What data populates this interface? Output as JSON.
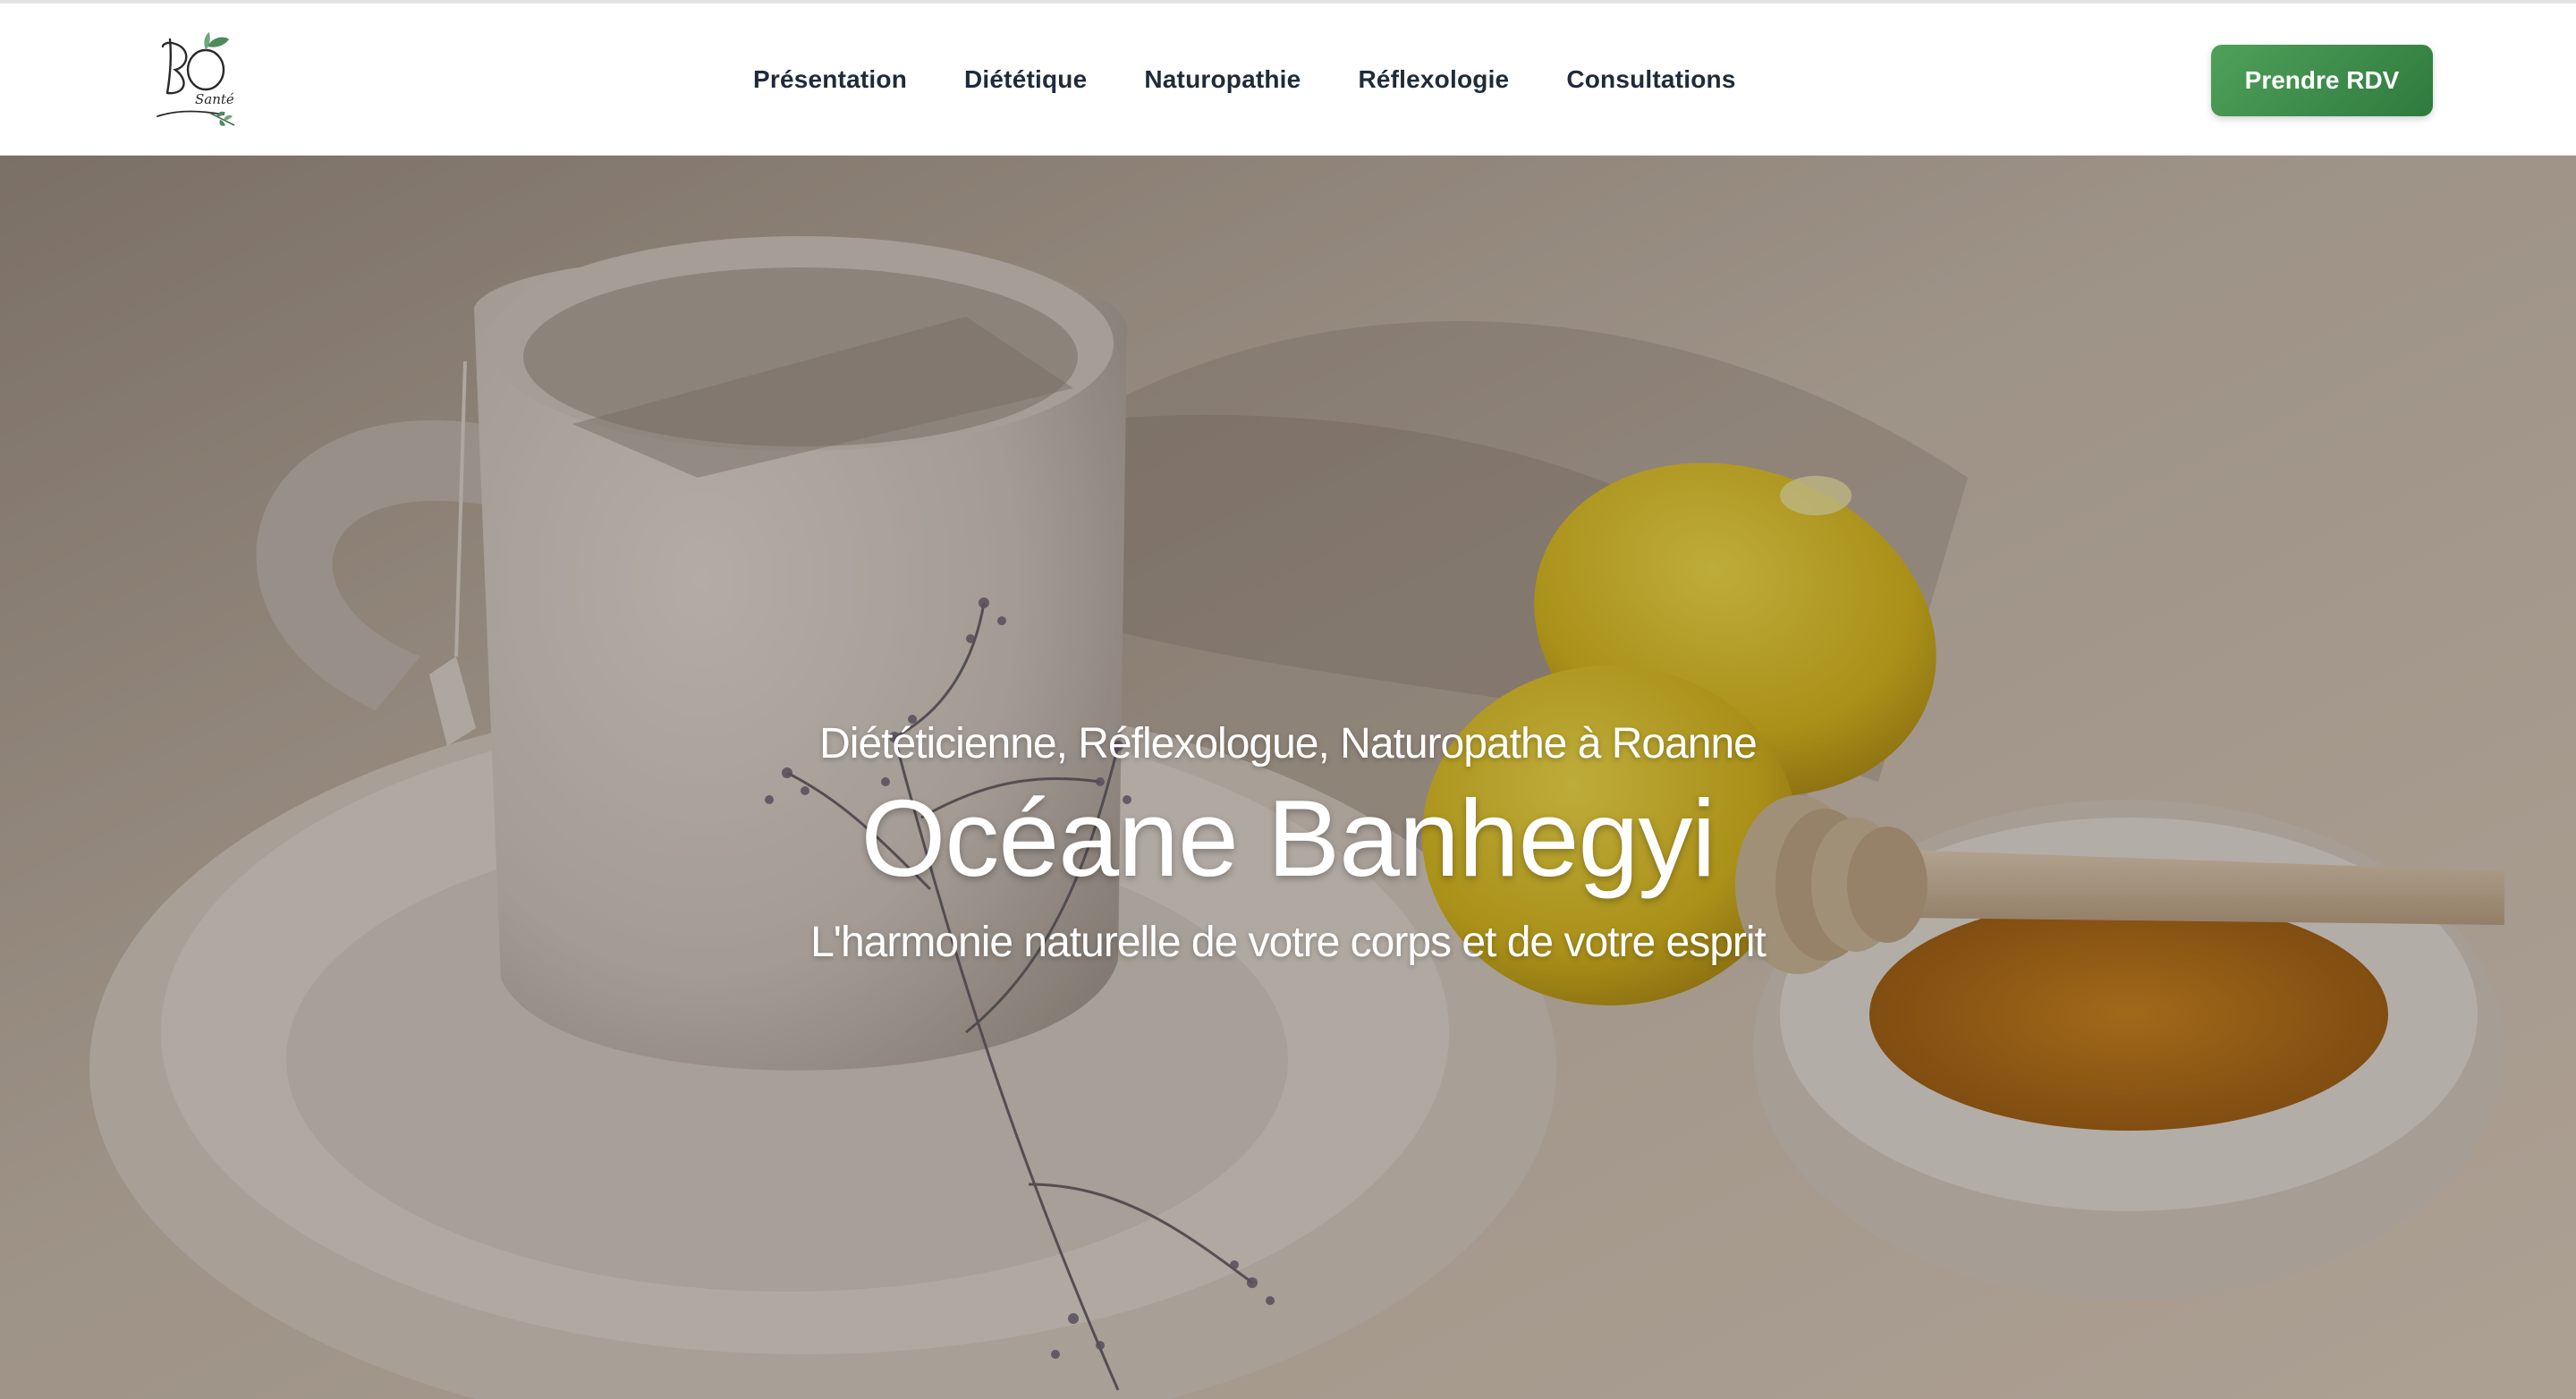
{
  "header": {
    "logo": {
      "text": "BO",
      "tagline": "Santé"
    },
    "nav": [
      {
        "label": "Présentation"
      },
      {
        "label": "Diététique"
      },
      {
        "label": "Naturopathie"
      },
      {
        "label": "Réflexologie"
      },
      {
        "label": "Consultations"
      }
    ],
    "cta_label": "Prendre RDV"
  },
  "hero": {
    "pretitle": "Diététicienne, Réflexologue, Naturopathe à Roanne",
    "title": "Océane Banhegyi",
    "subtitle": "L'harmonie naturelle de votre corps et de votre esprit"
  },
  "colors": {
    "accent": "#3f8f4c",
    "nav_text": "#1f2b3a",
    "overlay": "#281e16"
  }
}
